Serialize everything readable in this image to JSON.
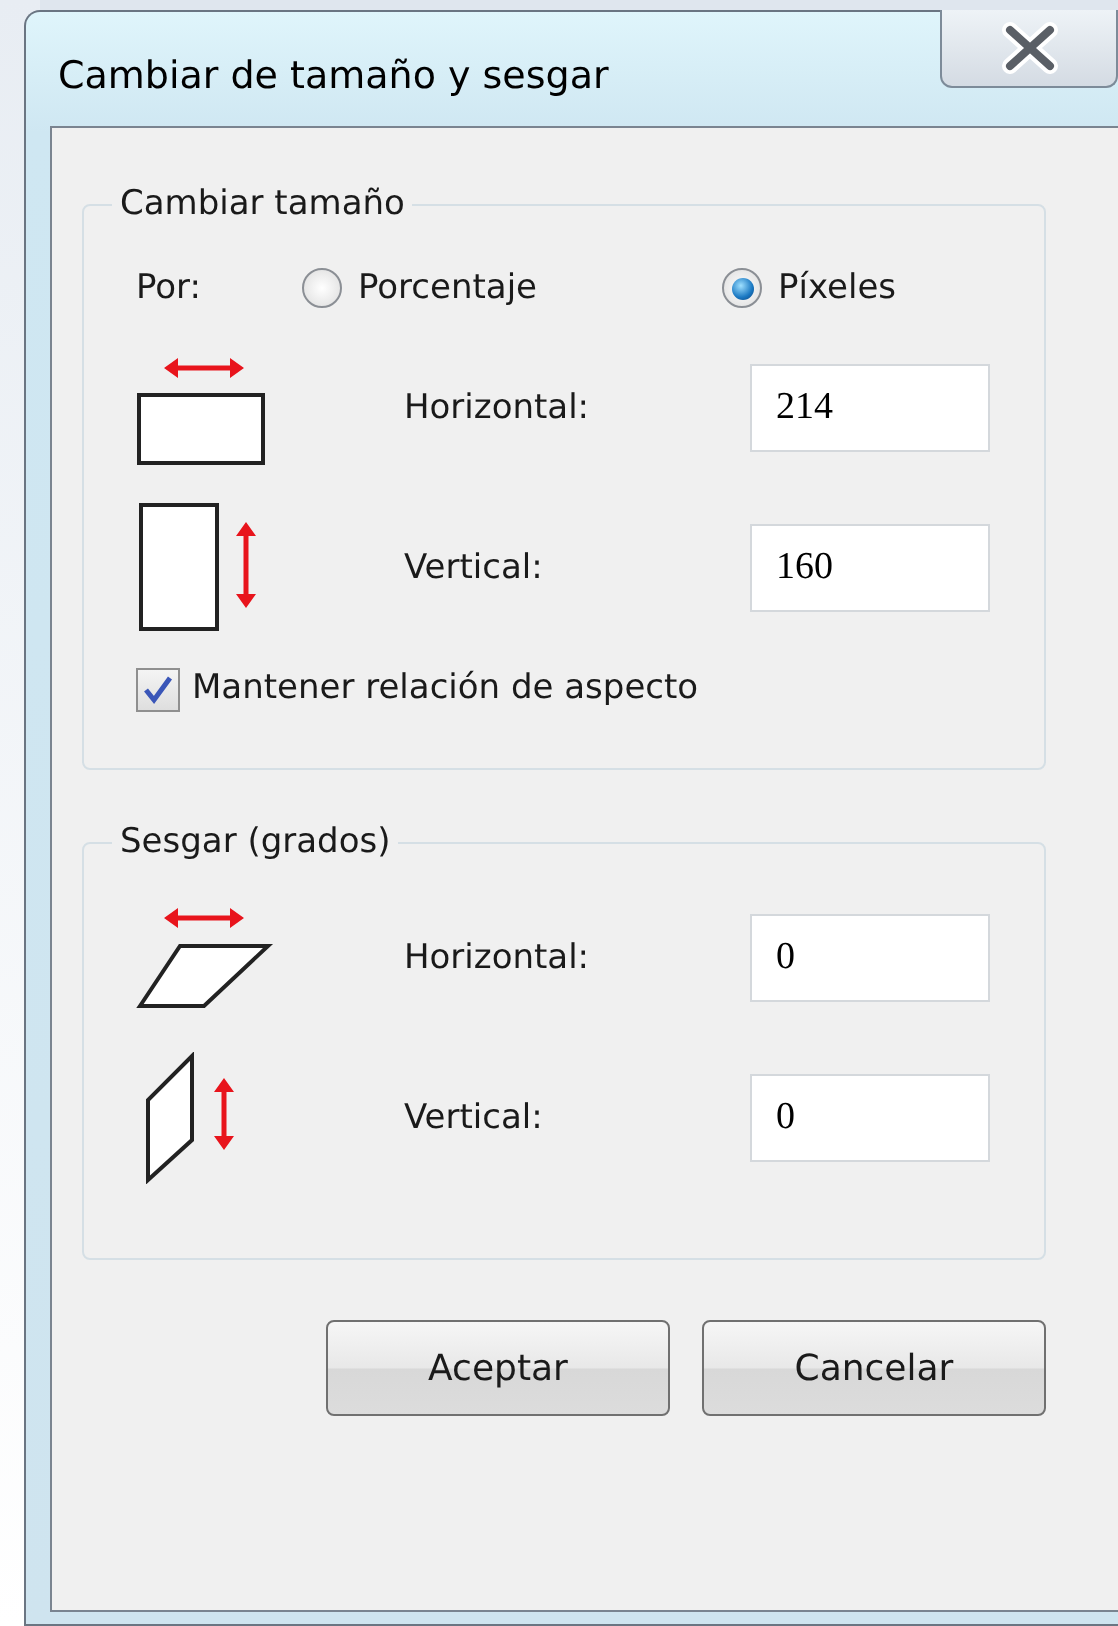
{
  "window": {
    "title": "Cambiar de tamaño y sesgar"
  },
  "resize": {
    "title": "Cambiar tamaño",
    "by_label": "Por:",
    "options": [
      {
        "label": "Porcentaje",
        "selected": false
      },
      {
        "label": "Píxeles",
        "selected": true
      }
    ],
    "fields": [
      {
        "kind": "horizontal",
        "label": "Horizontal:",
        "value": "214"
      },
      {
        "kind": "vertical",
        "label": "Vertical:",
        "value": "160"
      }
    ],
    "keep_aspect": {
      "label": "Mantener relación de aspecto",
      "checked": true
    }
  },
  "skew": {
    "title": "Sesgar (grados)",
    "fields": [
      {
        "kind": "horizontal",
        "label": "Horizontal:",
        "value": "0"
      },
      {
        "kind": "vertical",
        "label": "Vertical:",
        "value": "0"
      }
    ]
  },
  "buttons": [
    "Aceptar",
    "Cancelar"
  ]
}
